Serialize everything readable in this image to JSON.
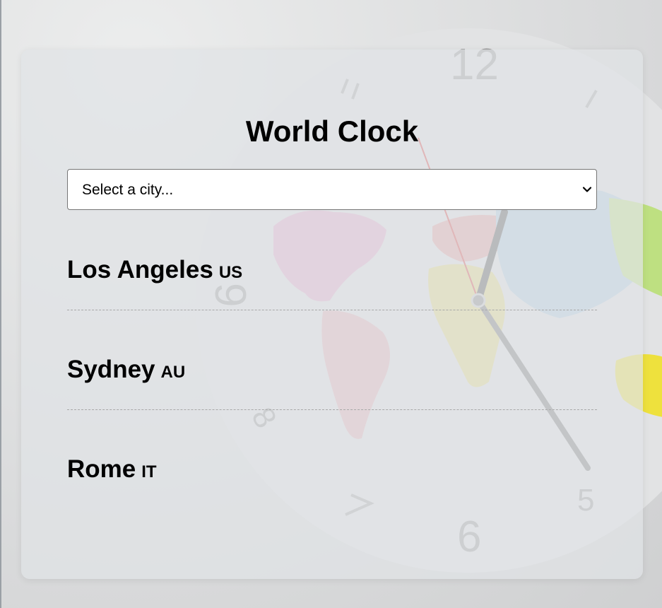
{
  "app": {
    "title": "World Clock"
  },
  "city_select": {
    "placeholder": "Select a city...",
    "icon": "chevron-down-icon"
  },
  "cities": [
    {
      "name": "Los Angeles",
      "code": "US"
    },
    {
      "name": "Sydney",
      "code": "AU"
    },
    {
      "name": "Rome",
      "code": "IT"
    }
  ],
  "background": {
    "description_icon": "world-map-clock-image",
    "clock_numbers": [
      "12",
      "11",
      "1",
      "9",
      "8",
      "7",
      "6",
      "5"
    ]
  },
  "colors": {
    "card": "#e1e3e6",
    "text": "#000000",
    "divider": "#a8a8a8",
    "clock_face": "#e4e5e6",
    "clock_numerals": "#9a9a9a"
  }
}
